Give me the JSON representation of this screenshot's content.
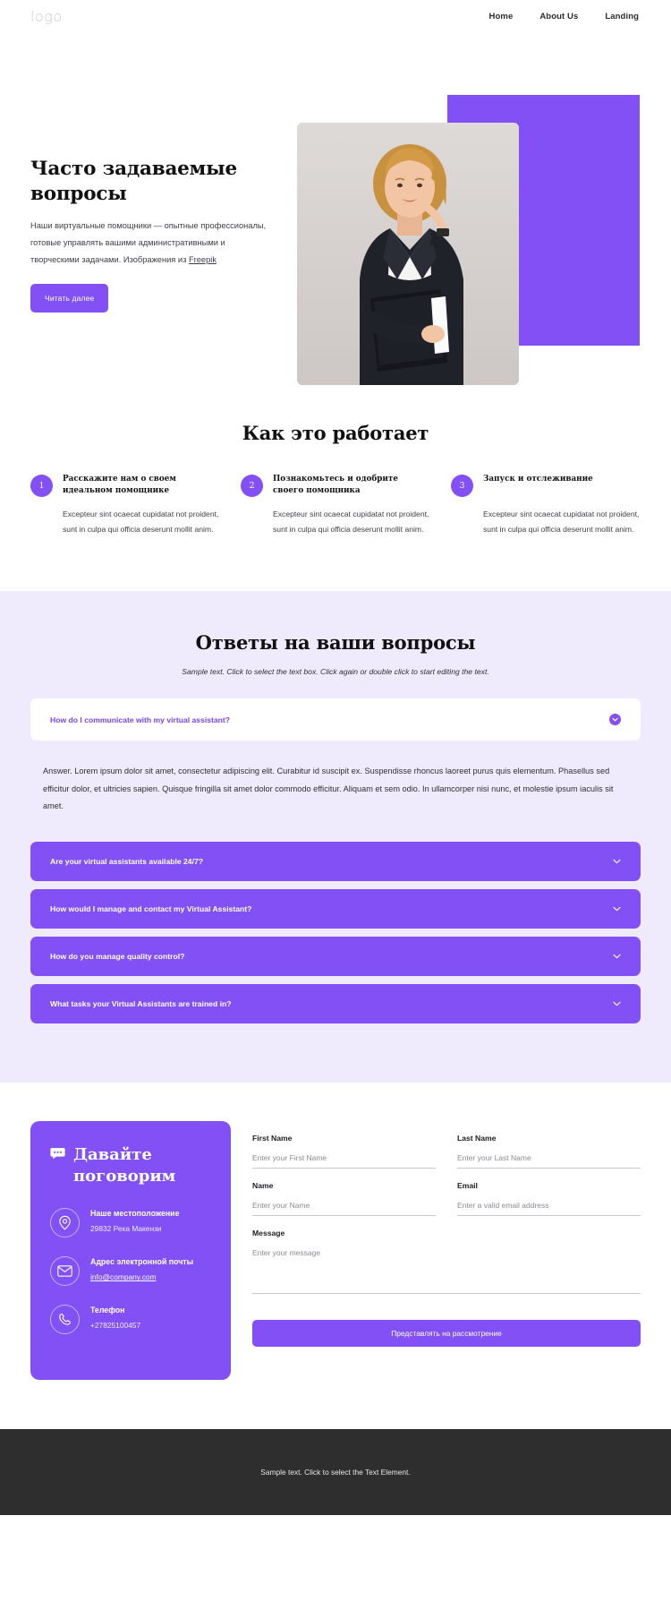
{
  "header": {
    "logo": "logo",
    "nav": [
      {
        "label": "Home"
      },
      {
        "label": "About Us"
      },
      {
        "label": "Landing"
      }
    ]
  },
  "hero": {
    "title": "Часто задаваемые вопросы",
    "text_before_link": "Наши виртуальные помощники — опытные профессионалы, готовые управлять вашими административными и творческими задачами. Изображения из ",
    "link_label": "Freepik",
    "button": "Читать далее",
    "image_alt": "businesswoman-holding-folder"
  },
  "how": {
    "title": "Как это работает",
    "steps": [
      {
        "num": "1",
        "title": "Расскажите нам о своем идеальном помощнике",
        "desc": "Excepteur sint ocaecat cupidatat not proident, sunt in culpa qui officia deserunt mollit anim."
      },
      {
        "num": "2",
        "title": "Познакомьтесь и одобрите своего помощника",
        "desc": "Excepteur sint ocaecat cupidatat not proident, sunt in culpa qui officia deserunt mollit anim."
      },
      {
        "num": "3",
        "title": "Запуск и отслеживание",
        "desc": "Excepteur sint ocaecat cupidatat not proident, sunt in culpa qui officia deserunt mollit anim."
      }
    ]
  },
  "faq": {
    "title": "Ответы на ваши вопросы",
    "subtitle": "Sample text. Click to select the text box. Click again or double click to start editing the text.",
    "open_item": {
      "question": "How do I communicate with my virtual assistant?",
      "answer": "Answer. Lorem ipsum dolor sit amet, consectetur adipiscing elit. Curabitur id suscipit ex. Suspendisse rhoncus laoreet purus quis elementum. Phasellus sed efficitur dolor, et ultricies sapien. Quisque fringilla sit amet dolor commodo efficitur. Aliquam et sem odio. In ullamcorper nisi nunc, et molestie ipsum iaculis sit amet."
    },
    "items": [
      {
        "question": "Are your virtual assistants available 24/7?"
      },
      {
        "question": "How would I manage and contact my Virtual Assistant?"
      },
      {
        "question": "How do you manage quality control?"
      },
      {
        "question": "What tasks your Virtual Assistants are trained in?"
      }
    ]
  },
  "contact": {
    "title": "Давайте поговорим",
    "rows": [
      {
        "icon": "location-pin-icon",
        "label": "Наше местоположение",
        "value": "29832 Река Макензи",
        "is_link": false
      },
      {
        "icon": "envelope-icon",
        "label": "Адрес электронной почты",
        "value": "info@company.com",
        "is_link": true
      },
      {
        "icon": "phone-icon",
        "label": "Телефон",
        "value": "+27825100457",
        "is_link": false
      }
    ],
    "form": {
      "first_name": {
        "label": "First Name",
        "placeholder": "Enter your First Name",
        "value": ""
      },
      "last_name": {
        "label": "Last Name",
        "placeholder": "Enter your Last Name",
        "value": ""
      },
      "name": {
        "label": "Name",
        "placeholder": "Enter your Name",
        "value": ""
      },
      "email": {
        "label": "Email",
        "placeholder": "Enter a valid email address",
        "value": ""
      },
      "message": {
        "label": "Message",
        "placeholder": "Enter your message",
        "value": ""
      },
      "submit": "Представлять на рассмотрение"
    }
  },
  "footer": {
    "text": "Sample text. Click to select the Text Element."
  },
  "colors": {
    "accent": "#8250F4",
    "faq_background": "#EFEBFD",
    "footer_background": "#2E2E2E",
    "link": "#7447E8"
  }
}
